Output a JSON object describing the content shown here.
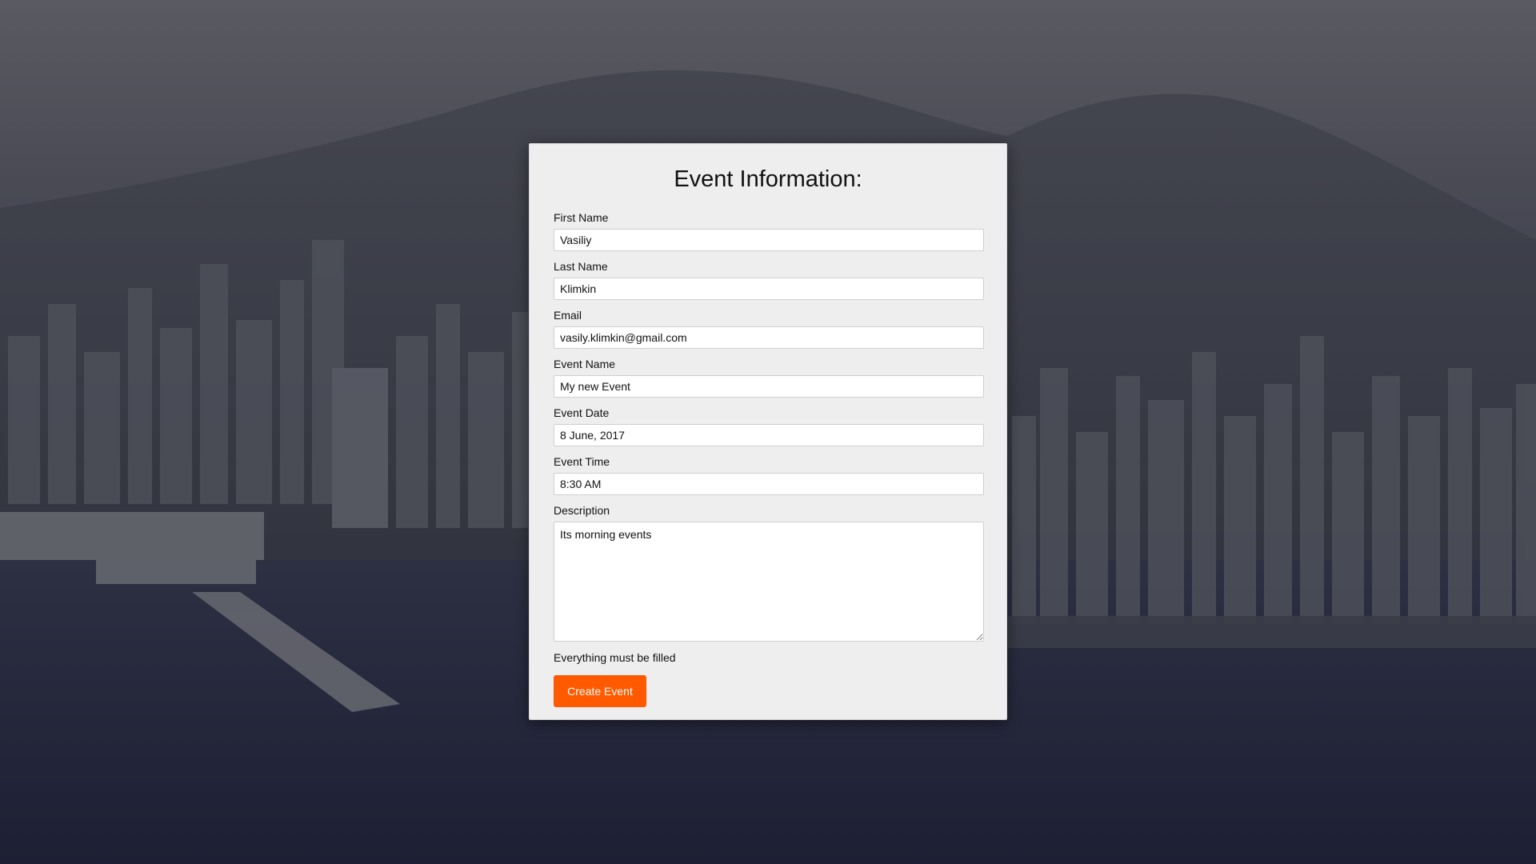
{
  "form": {
    "title": "Event Information:",
    "fields": {
      "first_name": {
        "label": "First Name",
        "value": "Vasiliy"
      },
      "last_name": {
        "label": "Last Name",
        "value": "Klimkin"
      },
      "email": {
        "label": "Email",
        "value": "vasily.klimkin@gmail.com"
      },
      "event_name": {
        "label": "Event Name",
        "value": "My new Event"
      },
      "event_date": {
        "label": "Event Date",
        "value": "8 June, 2017"
      },
      "event_time": {
        "label": "Event Time",
        "value": "8:30 AM"
      },
      "description": {
        "label": "Description",
        "value": "Its morning events"
      }
    },
    "note": "Everything must be filled",
    "submit_label": "Create Event"
  },
  "colors": {
    "accent": "#ff5a00",
    "card_bg": "#eeeeee",
    "page_bg": "#2a2d40"
  }
}
